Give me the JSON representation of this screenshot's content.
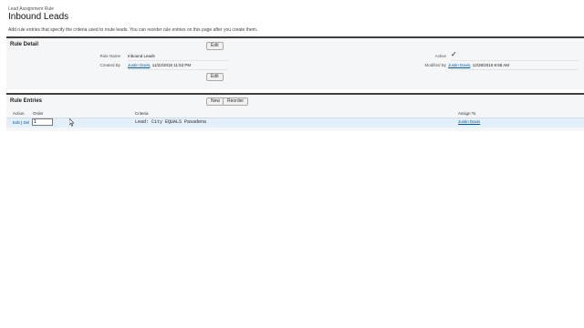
{
  "header": {
    "object_type": "Lead Assignment Rule",
    "title": "Inbound Leads",
    "description": "Add rule entries that specify the criteria used to route leads. You can reorder rule entries on this page after you create them."
  },
  "rule_detail": {
    "section_title": "Rule Detail",
    "edit_label": "Edit",
    "rule_name_label": "Rule Name",
    "rule_name": "Inbound Leads",
    "active_label": "Active",
    "active_mark": "✓",
    "created_by_label": "Created By",
    "created_by_user": "Justin Davis",
    "created_by_date": ", 11/22/2015 11:53 PM",
    "modified_by_label": "Modified By",
    "modified_by_user": "Justin Davis",
    "modified_by_date": ", 12/28/2015 8:58 AM"
  },
  "rule_entries": {
    "section_title": "Rule Entries",
    "new_label": "New",
    "reorder_label": "Reorder",
    "columns": {
      "action": "Action",
      "order": "Order",
      "criteria": "Criteria",
      "assign_to": "Assign To"
    },
    "rows": [
      {
        "edit": "Edit",
        "separator": " | ",
        "delete": "Del",
        "order": "1",
        "criteria": "Lead: City EQUALS Pasadena",
        "assign_to": "Justin Davis"
      }
    ]
  }
}
